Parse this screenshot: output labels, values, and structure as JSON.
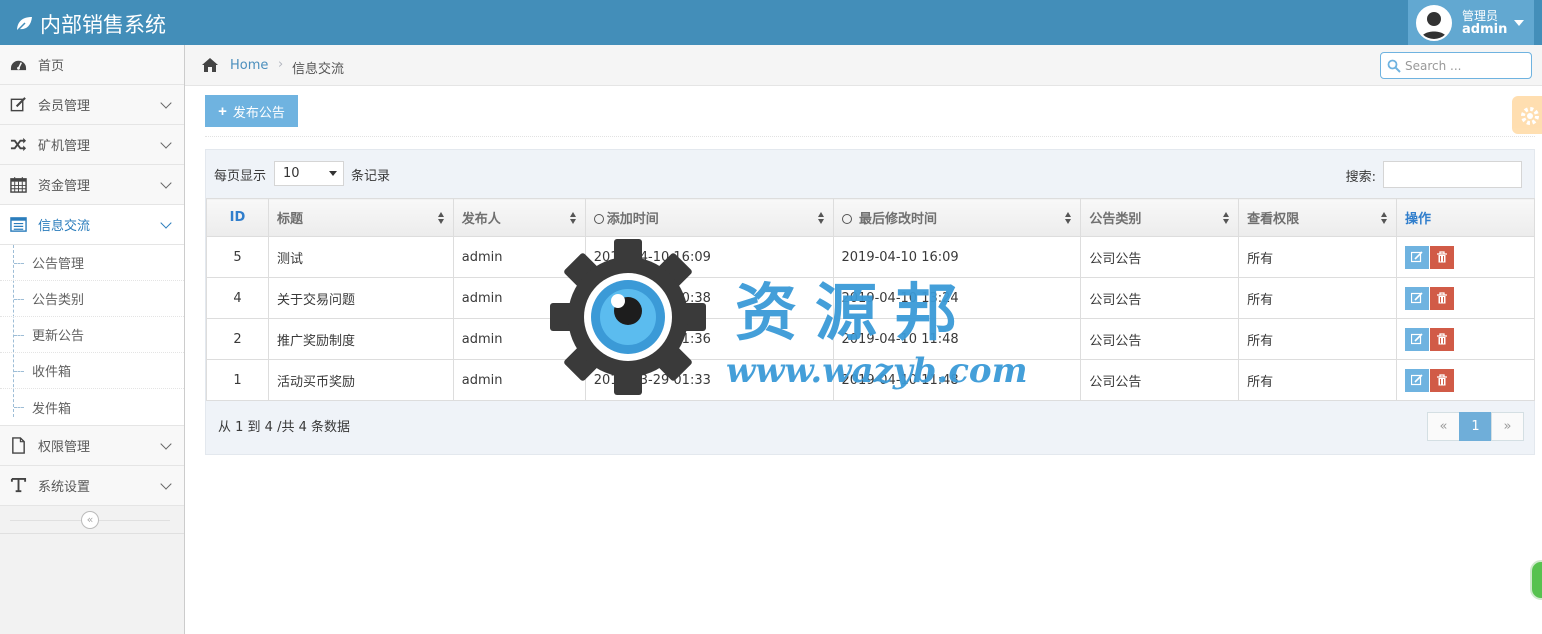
{
  "app": {
    "title": "内部销售系统"
  },
  "user": {
    "role": "管理员",
    "name": "admin"
  },
  "sidebar": {
    "items": [
      {
        "label": "首页",
        "icon": "dashboard-icon"
      },
      {
        "label": "会员管理",
        "icon": "edit-icon"
      },
      {
        "label": "矿机管理",
        "icon": "shuffle-icon"
      },
      {
        "label": "资金管理",
        "icon": "calendar-icon"
      },
      {
        "label": "信息交流",
        "icon": "list-icon"
      }
    ],
    "sub_items": [
      "公告管理",
      "公告类别",
      "更新公告",
      "收件箱",
      "发件箱"
    ],
    "items_after": [
      {
        "label": "权限管理",
        "icon": "file-icon"
      },
      {
        "label": "系统设置",
        "icon": "text-icon"
      }
    ],
    "collapse_glyph": "«"
  },
  "breadcrumb": {
    "home": "Home",
    "separator": "›",
    "current": "信息交流"
  },
  "search": {
    "placeholder": "Search ..."
  },
  "toolbar": {
    "publish_label": "发布公告"
  },
  "table_controls": {
    "length_prefix": "每页显示",
    "length_value": "10",
    "length_suffix": "条记录",
    "filter_label": "搜索:"
  },
  "table": {
    "columns": [
      "ID",
      "标题",
      "发布人",
      "添加时间",
      "最后修改时间",
      "公告类别",
      "查看权限",
      "操作"
    ],
    "rows": [
      {
        "id": "5",
        "title": "测试",
        "author": "admin",
        "added": "2019-04-10 16:09",
        "modified": "2019-04-10 16:09",
        "category": "公司公告",
        "permission": "所有"
      },
      {
        "id": "4",
        "title": "关于交易问题",
        "author": "admin",
        "added": "2019-03-30 00:38",
        "modified": "2019-04-10 13:24",
        "category": "公司公告",
        "permission": "所有"
      },
      {
        "id": "2",
        "title": "推广奖励制度",
        "author": "admin",
        "added": "2019-03-29 01:36",
        "modified": "2019-04-10 11:48",
        "category": "公司公告",
        "permission": "所有"
      },
      {
        "id": "1",
        "title": "活动买币奖励",
        "author": "admin",
        "added": "2019-03-29 01:33",
        "modified": "2019-04-10 11:48",
        "category": "公司公告",
        "permission": "所有"
      }
    ]
  },
  "footer": {
    "info": "从 1 到 4 /共 4 条数据"
  },
  "pagination": {
    "prev": "«",
    "current": "1",
    "next": "»"
  },
  "watermark": {
    "text": "资源邦",
    "url": "www.wazyb.com"
  },
  "colors": {
    "navbar": "#438eb9",
    "accent": "#6fb3e0",
    "danger": "#d15b47",
    "link": "#2b7dbc"
  }
}
